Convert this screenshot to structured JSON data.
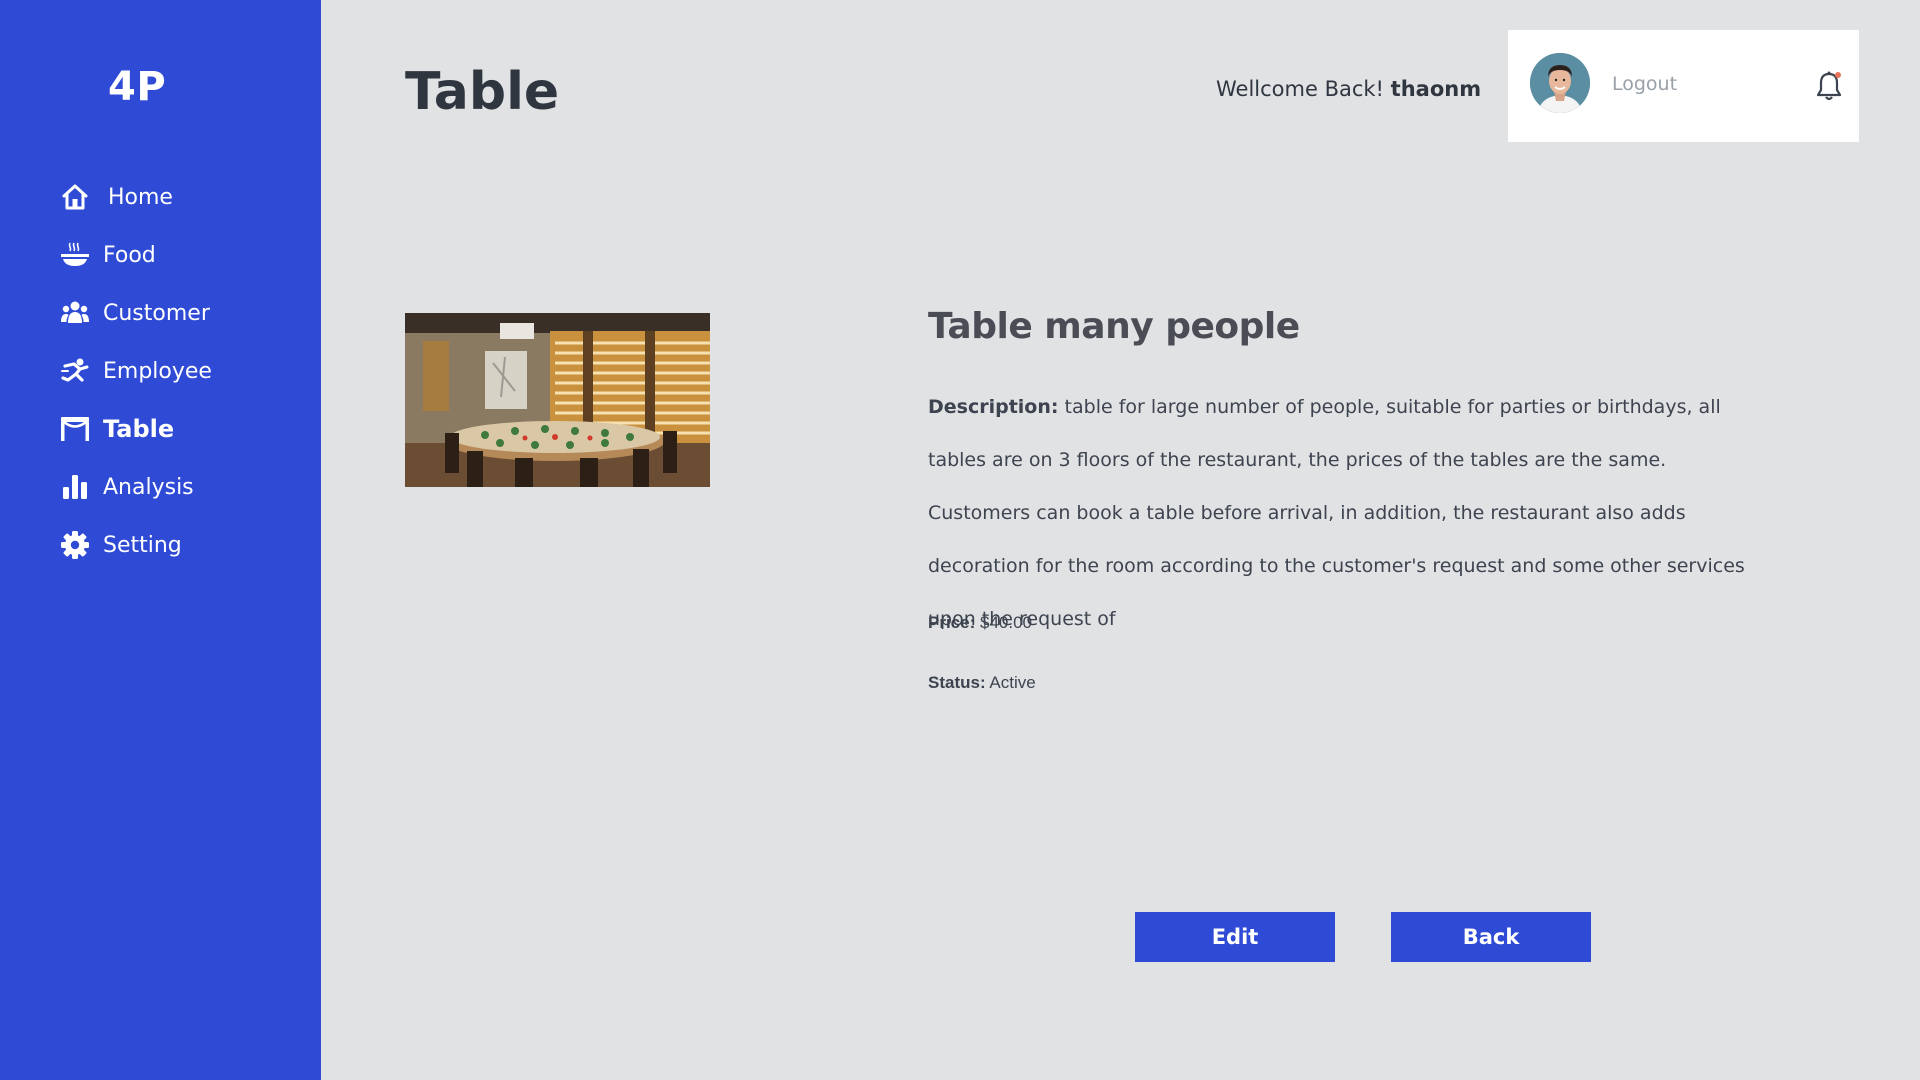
{
  "app": {
    "logo": "4P"
  },
  "sidebar": {
    "items": [
      {
        "label": "Home",
        "icon": "home-icon"
      },
      {
        "label": "Food",
        "icon": "food-bowl-icon"
      },
      {
        "label": "Customer",
        "icon": "users-icon"
      },
      {
        "label": "Employee",
        "icon": "employee-icon"
      },
      {
        "label": "Table",
        "icon": "table-icon",
        "active": true
      },
      {
        "label": "Analysis",
        "icon": "bar-chart-icon"
      },
      {
        "label": "Setting",
        "icon": "gear-icon"
      }
    ]
  },
  "header": {
    "title": "Table",
    "welcome_text": "Wellcome Back!",
    "username": "thaonm",
    "logout_label": "Logout"
  },
  "detail": {
    "title": "Table many people",
    "description_label": "Description:",
    "description": "table for large number of people, suitable for parties or birthdays, all tables are on 3 floors  of the restaurant, the prices of the tables are the same. Customers can book a table before  arrival, in addition, the  restaurant  also  adds  decoration  for  the room according  to  the  customer's  request and some  other services upon the request of",
    "price_label": "Price:",
    "price": "$40.00",
    "status_label": "Status:",
    "status": "Active"
  },
  "actions": {
    "edit_label": "Edit",
    "back_label": "Back"
  },
  "colors": {
    "sidebar": "#2f4bd6",
    "background": "#e1e2e4",
    "button": "#2f4bd6",
    "notification_dot": "#e8735a"
  }
}
